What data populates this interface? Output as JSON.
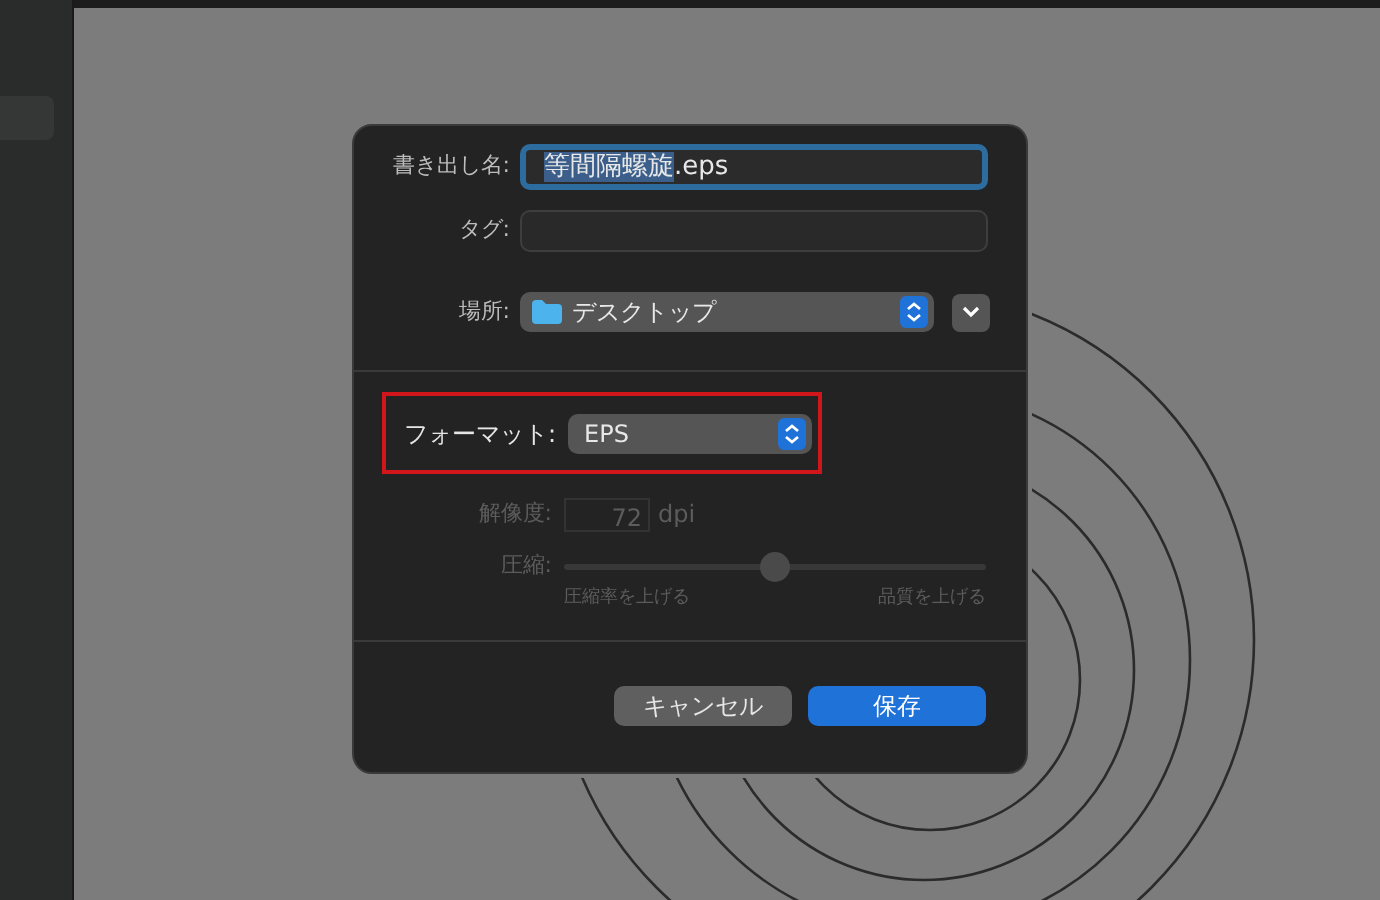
{
  "dialog": {
    "export_name": {
      "label": "書き出し名:",
      "selected_text": "等間隔螺旋",
      "rest_text": ".eps",
      "focused": true
    },
    "tags": {
      "label": "タグ:"
    },
    "location": {
      "label": "場所:",
      "value": "デスクトップ"
    },
    "format": {
      "label": "フォーマット:",
      "value": "EPS",
      "highlighted": true
    },
    "resolution": {
      "label": "解像度:",
      "value": "72",
      "unit": "dpi",
      "disabled": true
    },
    "compression": {
      "label": "圧縮:",
      "level": 0.5,
      "min_label": "圧縮率を上げる",
      "max_label": "品質を上げる",
      "disabled": true
    },
    "buttons": [
      {
        "label": "キャンセル",
        "kind": "secondary"
      },
      {
        "label": "保存",
        "kind": "primary"
      }
    ]
  }
}
